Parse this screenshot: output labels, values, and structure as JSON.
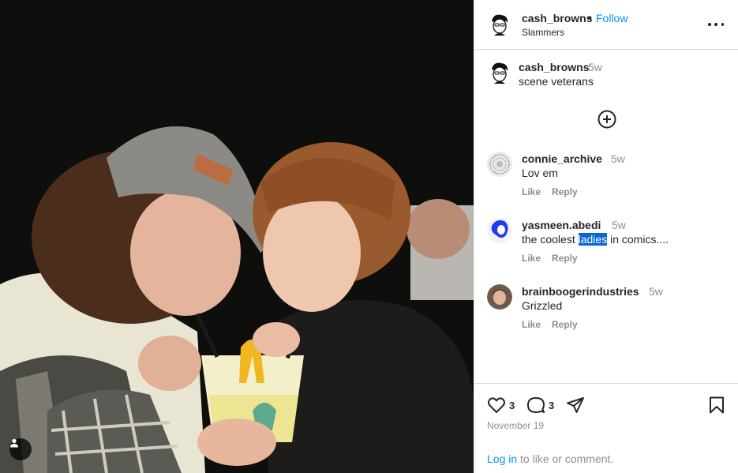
{
  "post": {
    "author": "cash_browns",
    "follow_label": "Follow",
    "separator": "•",
    "subtitle": "Slammers"
  },
  "caption": {
    "author": "cash_browns",
    "time": "5w",
    "text": "scene veterans"
  },
  "comments": [
    {
      "author": "connie_archive",
      "time": "5w",
      "text": "Lov em",
      "like_label": "Like",
      "reply_label": "Reply"
    },
    {
      "author": "yasmeen.abedi",
      "time": "5w",
      "text_before": "the coolest ",
      "text_highlight": "ladies",
      "text_after": " in comics....",
      "like_label": "Like",
      "reply_label": "Reply"
    },
    {
      "author": "brainboogerindustries",
      "time": "5w",
      "text": "Grizzled",
      "like_label": "Like",
      "reply_label": "Reply"
    }
  ],
  "stats": {
    "likes": "3",
    "comments": "3",
    "date": "November 19"
  },
  "login": {
    "link": "Log in",
    "rest": " to like or comment."
  },
  "colors": {
    "link_blue": "#0095f6",
    "muted": "#8e8e8e",
    "text": "#262626",
    "selection": "#0a64d6"
  },
  "icons": [
    "user-tag-icon",
    "more-options-icon",
    "add-circle-icon",
    "heart-icon",
    "comment-icon",
    "share-icon",
    "bookmark-icon"
  ]
}
